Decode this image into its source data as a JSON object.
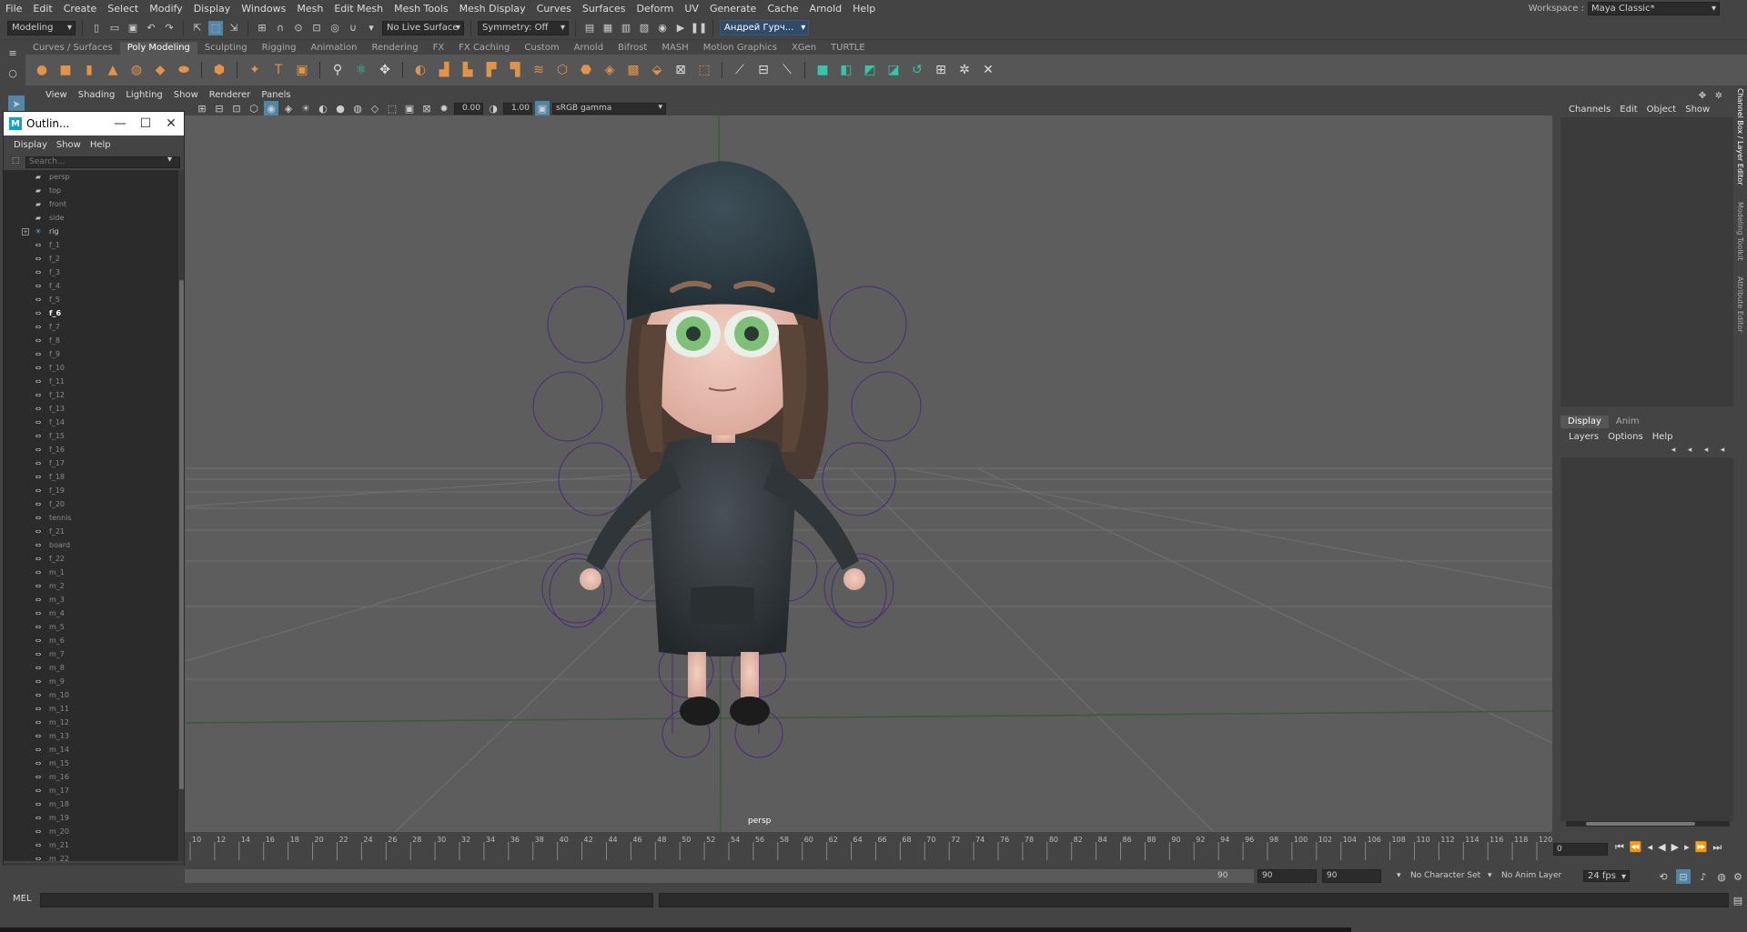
{
  "menubar": {
    "items": [
      "File",
      "Edit",
      "Create",
      "Select",
      "Modify",
      "Display",
      "Windows",
      "Mesh",
      "Edit Mesh",
      "Mesh Tools",
      "Mesh Display",
      "Curves",
      "Surfaces",
      "Deform",
      "UV",
      "Generate",
      "Cache",
      "Arnold",
      "Help"
    ],
    "workspace_label": "Workspace :",
    "workspace_value": "Maya Classic*"
  },
  "statusline": {
    "mode": "Modeling",
    "live_surface": "No Live Surface",
    "symmetry": "Symmetry: Off",
    "user": "Андрей Гурч..."
  },
  "shelf": {
    "tabs": [
      "Curves / Surfaces",
      "Poly Modeling",
      "Sculpting",
      "Rigging",
      "Animation",
      "Rendering",
      "FX",
      "FX Caching",
      "Custom",
      "Arnold",
      "Bifrost",
      "MASH",
      "Motion Graphics",
      "XGen",
      "TURTLE"
    ],
    "active_tab": "Poly Modeling"
  },
  "viewport": {
    "menu": [
      "View",
      "Shading",
      "Lighting",
      "Show",
      "Renderer",
      "Panels"
    ],
    "exposure": "0.00",
    "gamma": "1.00",
    "colorspace": "sRGB gamma",
    "camera_label": "persp"
  },
  "outliner": {
    "title": "Outlin...",
    "menu": [
      "Display",
      "Show",
      "Help"
    ],
    "search_placeholder": "Search...",
    "cameras": [
      "persp",
      "top",
      "front",
      "side"
    ],
    "rig": "rig",
    "items": [
      "f_1",
      "f_2",
      "f_3",
      "f_4",
      "f_5",
      "f_6",
      "f_7",
      "f_8",
      "f_9",
      "f_10",
      "f_11",
      "f_12",
      "f_13",
      "f_14",
      "f_15",
      "f_16",
      "f_17",
      "f_18",
      "f_19",
      "f_20",
      "tennis",
      "f_21",
      "board",
      "f_22",
      "m_1",
      "m_2",
      "m_3",
      "m_4",
      "m_5",
      "m_6",
      "m_7",
      "m_8",
      "m_9",
      "m_10",
      "m_11",
      "m_12",
      "m_13",
      "m_14",
      "m_15",
      "m_16",
      "m_17",
      "m_18",
      "m_19",
      "m_20",
      "m_21",
      "m_22"
    ],
    "highlighted": "f_6"
  },
  "channelbox": {
    "menu": [
      "Channels",
      "Edit",
      "Object",
      "Show"
    ],
    "layer_tabs": [
      "Display",
      "Anim"
    ],
    "layer_menu": [
      "Layers",
      "Options",
      "Help"
    ],
    "side_tabs": [
      "Channel Box / Layer Editor",
      "Modeling Toolkit",
      "Attribute Editor"
    ]
  },
  "timeline": {
    "ticks": [
      10,
      12,
      14,
      16,
      18,
      20,
      22,
      24,
      26,
      28,
      30,
      32,
      34,
      36,
      38,
      40,
      42,
      44,
      46,
      48,
      50,
      52,
      54,
      56,
      58,
      60,
      62,
      64,
      66,
      68,
      70,
      72,
      74,
      76,
      78,
      80,
      82,
      84,
      86,
      88,
      90,
      92,
      94,
      96,
      98,
      100,
      102,
      104,
      106,
      108,
      110,
      112,
      114,
      116,
      118,
      120
    ],
    "current_frame": "0"
  },
  "range": {
    "slider_end": "90",
    "end_time": "90",
    "max_time": "90",
    "character_set": "No Character Set",
    "anim_layer": "No Anim Layer",
    "fps": "24 fps"
  },
  "cmdline": {
    "lang": "MEL"
  },
  "colors": {
    "panel": "#444444",
    "viewport": "#5d5d5d",
    "accent": "#e0934a",
    "rig": "#5a2a8a"
  }
}
